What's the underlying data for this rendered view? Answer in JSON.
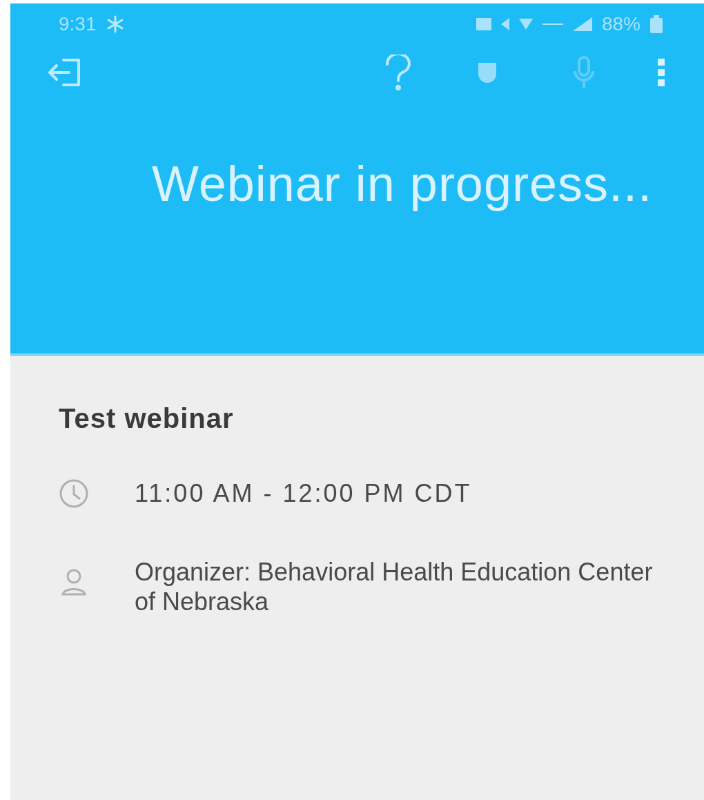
{
  "status_bar": {
    "time": "9:31",
    "battery": "88%"
  },
  "banner": {
    "title": "Webinar in progress..."
  },
  "details": {
    "title": "Test webinar",
    "time": "11:00 AM - 12:00 PM CDT",
    "organizer": "Organizer: Behavioral Health Education Center of Nebraska"
  }
}
